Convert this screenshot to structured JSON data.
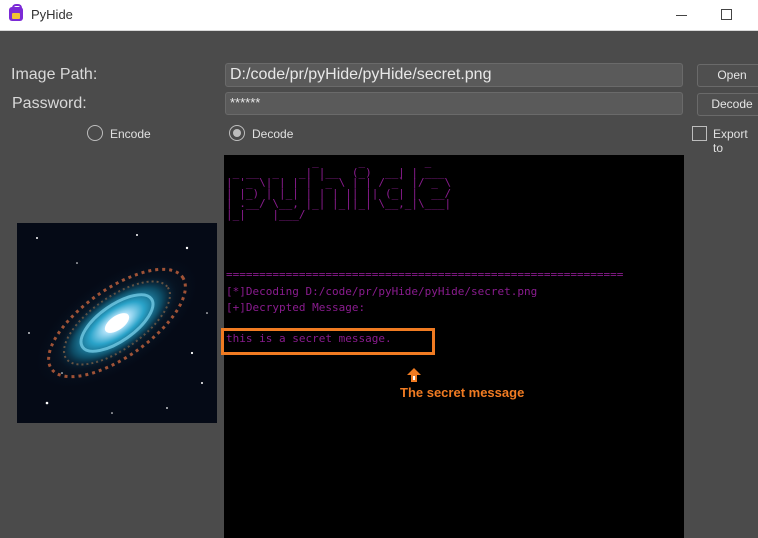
{
  "window": {
    "title": "PyHide"
  },
  "form": {
    "image_path_label": "Image Path:",
    "image_path_value": "D:/code/pr/pyHide/pyHide/secret.png",
    "password_label": "Password:",
    "password_value": "******",
    "open_button": "Open",
    "decode_button": "Decode",
    "mode": {
      "encode_label": "Encode",
      "decode_label": "Decode",
      "selected": "Decode"
    },
    "export_label": "Export to",
    "export_checked": false
  },
  "console": {
    "ascii_banner": "             _      _         _\n _ __  _   _| |__  (_)  __| | ___\n| '_ \\| | | | '_ \\ | | / _` |/ _ \\\n| |_) | |_| | | | || || (_| |  __/\n| .__/ \\__, |_| |_||_| \\__,_|\\___|\n|_|    |___/",
    "separator": "============================================================",
    "line_decoding": "[*]Decoding D:/code/pr/pyHide/pyHide/secret.png",
    "line_decrypted": "[+]Decrypted Message:",
    "secret_message": "this is a secret message."
  },
  "annotation": {
    "label": "The secret message",
    "color": "#f07b22"
  },
  "icons": [
    "lock-icon",
    "up-arrow-icon"
  ]
}
